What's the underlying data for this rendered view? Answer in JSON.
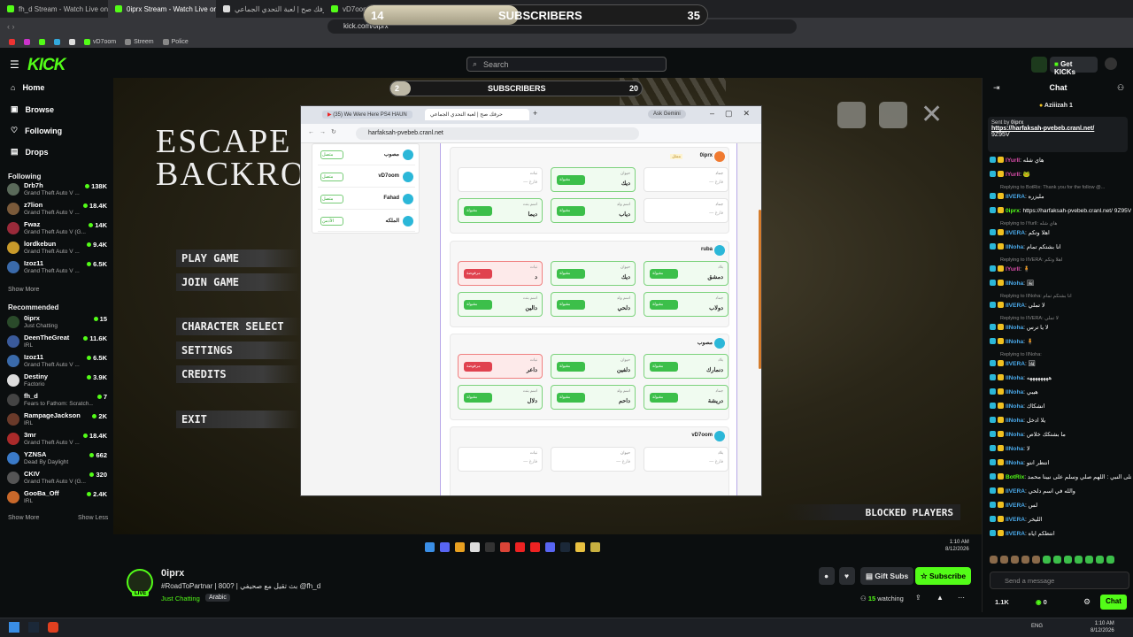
{
  "browser": {
    "tabs": [
      {
        "label": "fh_d Stream - Watch Live on Kick",
        "active": false
      },
      {
        "label": "0iprx Stream - Watch Live on Kick",
        "active": true
      },
      {
        "label": "حرفك صح | لعبة التحدي الجماعي",
        "active": false
      },
      {
        "label": "vD7oom",
        "active": false
      }
    ],
    "url": "kick.com/0iprx",
    "bookmarks": [
      "vD7oom",
      "Streem",
      "Police"
    ]
  },
  "overlay_subscribers": {
    "left": "14",
    "label": "SUBSCRIBERS",
    "right": "35",
    "progress": 0.45
  },
  "kick_header": {
    "logo": "KICK",
    "search_placeholder": "Search",
    "get_kicks": "Get KICKs"
  },
  "sidebar": {
    "nav": [
      "Home",
      "Browse",
      "Following",
      "Drops"
    ],
    "following_title": "Following",
    "following": [
      {
        "name": "Drb7h",
        "game": "Grand Theft Auto V ...",
        "viewers": "138K",
        "color": "#5a6a5a"
      },
      {
        "name": "z7lion",
        "game": "Grand Theft Auto V ...",
        "viewers": "18.4K",
        "color": "#7a5a3a"
      },
      {
        "name": "Fwaz",
        "game": "Grand Theft Auto V (G...",
        "viewers": "14K",
        "color": "#9a2a3a"
      },
      {
        "name": "lordkebun",
        "game": "Grand Theft Auto V ...",
        "viewers": "9.4K",
        "color": "#c89a2a"
      },
      {
        "name": "Izoz11",
        "game": "Grand Theft Auto V ...",
        "viewers": "6.5K",
        "color": "#3a6aaa"
      }
    ],
    "show_more": "Show More",
    "recommended_title": "Recommended",
    "recommended": [
      {
        "name": "0iprx",
        "game": "Just Chatting",
        "viewers": "15",
        "color": "#2a4a2a"
      },
      {
        "name": "DeenTheGreat",
        "game": "IRL",
        "viewers": "11.6K",
        "color": "#3a5a9a"
      },
      {
        "name": "Izoz11",
        "game": "Grand Theft Auto V ...",
        "viewers": "6.5K",
        "color": "#3a6aaa"
      },
      {
        "name": "Destiny",
        "game": "Factorio",
        "viewers": "3.9K",
        "color": "#dddddd"
      },
      {
        "name": "fh_d",
        "game": "Fears to Fathom: Scratch...",
        "viewers": "7",
        "color": "#444"
      },
      {
        "name": "RampageJackson",
        "game": "IRL",
        "viewers": "2K",
        "color": "#6a3a2a"
      },
      {
        "name": "3mr",
        "game": "Grand Theft Auto V ...",
        "viewers": "18.4K",
        "color": "#aa2a2a"
      },
      {
        "name": "YZNSA",
        "game": "Dead By Daylight",
        "viewers": "662",
        "color": "#3a7ac8"
      },
      {
        "name": "CKIV",
        "game": "Grand Theft Auto V (G...",
        "viewers": "320",
        "color": "#555"
      },
      {
        "name": "GooBa_Off",
        "game": "IRL",
        "viewers": "2.4K",
        "color": "#c8682a"
      }
    ],
    "show_more2": "Show More",
    "show_less": "Show Less"
  },
  "game": {
    "title_line1": "ESCAPE",
    "title_line2": "BACKRO",
    "menu": [
      "PLAY GAME",
      "JOIN GAME",
      "CHARACTER SELECT",
      "SETTINGS",
      "CREDITS",
      "EXIT"
    ],
    "blocked": "BLOCKED PLAYERS",
    "subs_left": "2",
    "subs_label": "SUBSCRIBERS",
    "subs_right": "20",
    "subs_progress": 0.08
  },
  "inner_browser": {
    "tab1": "(35) We Were Here PS4 HAUN",
    "tab2": "حرفك صح | لعبة التحدي الجماعي",
    "ask": "Ask Gemini",
    "url": "harfaksah-pvebeb.cranl.net",
    "players": [
      {
        "name": "مصوب",
        "status": "متصل"
      },
      {
        "name": "vD7oom",
        "status": "متصل"
      },
      {
        "name": "Fahad",
        "status": "متصل"
      },
      {
        "name": "الملكه",
        "status": "الأدمن"
      }
    ],
    "cards": [
      {
        "title": "0iprx",
        "tag": "ممثل",
        "rows": [
          [
            {
              "l": "جماد",
              "v": "",
              "b": ""
            },
            {
              "l": "حيوان",
              "v": "ديك",
              "b": "g"
            },
            {
              "l": "نبات",
              "v": "",
              "b": ""
            }
          ],
          [
            {
              "l": "جماد",
              "v": "",
              "b": ""
            },
            {
              "l": "اسم ولد",
              "v": "دياب",
              "b": "g"
            },
            {
              "l": "اسم بنت",
              "v": "ديما",
              "b": "g"
            }
          ]
        ]
      },
      {
        "title": "ruba",
        "tag": "",
        "rows": [
          [
            {
              "l": "بلاد",
              "v": "دمشق",
              "b": "g"
            },
            {
              "l": "حيوان",
              "v": "ديك",
              "b": "g"
            },
            {
              "l": "نبات",
              "v": "د",
              "b": "r"
            }
          ],
          [
            {
              "l": "جماد",
              "v": "دولاب",
              "b": "g"
            },
            {
              "l": "اسم ولد",
              "v": "دلحي",
              "b": "g"
            },
            {
              "l": "اسم بنت",
              "v": "دالين",
              "b": "g"
            }
          ]
        ]
      },
      {
        "title": "مصوب",
        "tag": "",
        "rows": [
          [
            {
              "l": "بلاد",
              "v": "دنمارك",
              "b": "g"
            },
            {
              "l": "حيوان",
              "v": "دلفين",
              "b": "g"
            },
            {
              "l": "نبات",
              "v": "داعر",
              "b": "r"
            }
          ],
          [
            {
              "l": "جماد",
              "v": "دريشة",
              "b": "g"
            },
            {
              "l": "اسم ولد",
              "v": "داحم",
              "b": "g"
            },
            {
              "l": "اسم بنت",
              "v": "دلال",
              "b": "g"
            }
          ]
        ]
      },
      {
        "title": "vD7oom",
        "tag": "",
        "rows": [
          [
            {
              "l": "بلاد",
              "v": "",
              "b": ""
            },
            {
              "l": "حيوان",
              "v": "",
              "b": ""
            },
            {
              "l": "نبات",
              "v": "",
              "b": ""
            }
          ]
        ]
      }
    ],
    "badge_ok": "مقبولة",
    "badge_bad": "مرفوضة",
    "empty": "— فارغ"
  },
  "chat": {
    "title": "Chat",
    "top_user": "Aziiizah",
    "top_count": "1",
    "pinned_by": "Sent by",
    "pinned_user": "0iprx",
    "pinned_link": "https://harfaksah-pvebeb.cranl.net/",
    "pinned_code": "9Z95V",
    "messages": [
      {
        "u": "IYurlI",
        "c": "#d94ca8",
        "t": "هاي شله"
      },
      {
        "u": "IYurlI",
        "c": "#d94ca8",
        "t": "🐸"
      },
      {
        "r": "Replying to BotRix: Thank you for the follow @..."
      },
      {
        "u": "IIVERA",
        "c": "#4aa8e8",
        "t": "مليزره"
      },
      {
        "u": "0iprx",
        "c": "#53fc18",
        "t": "https://harfaksah-pvebeb.cranl.net/ 9Z95V"
      },
      {
        "r": "Replying to IYurlI: هاي شله"
      },
      {
        "u": "IIVERA",
        "c": "#4aa8e8",
        "t": "اهلا وتكم"
      },
      {
        "u": "IINoha",
        "c": "#4aa8e8",
        "t": "انا بشتكم تمام"
      },
      {
        "r": "Replying to IIVERA: اهلا وتكم"
      },
      {
        "u": "IYurlI",
        "c": "#d94ca8",
        "t": "🧍"
      },
      {
        "u": "IINoha",
        "c": "#4aa8e8",
        "t": "🖼"
      },
      {
        "r": "Replying to IINoha: انا بشتكم تمام"
      },
      {
        "u": "IIVERA",
        "c": "#4aa8e8",
        "t": "لا تملي"
      },
      {
        "r": "Replying to IIVERA: لا تملي"
      },
      {
        "u": "IINoha",
        "c": "#4aa8e8",
        "t": "لا يا ترس"
      },
      {
        "u": "IINoha",
        "c": "#4aa8e8",
        "t": "🧍"
      },
      {
        "r": "Replying to IINoha:"
      },
      {
        "u": "IIVERA",
        "c": "#4aa8e8",
        "t": "🖼"
      },
      {
        "u": "IINoha",
        "c": "#4aa8e8",
        "t": "ههههههههه"
      },
      {
        "u": "IINoha",
        "c": "#4aa8e8",
        "t": "هيبي"
      },
      {
        "u": "IINoha",
        "c": "#4aa8e8",
        "t": "انشكاك"
      },
      {
        "u": "IINoha",
        "c": "#4aa8e8",
        "t": "يلا ادخل"
      },
      {
        "u": "IINoha",
        "c": "#4aa8e8",
        "t": "ما بشتكك خلاص"
      },
      {
        "u": "IINoha",
        "c": "#4aa8e8",
        "t": "لا"
      },
      {
        "u": "IINoha",
        "c": "#4aa8e8",
        "t": "انتظر انتو"
      },
      {
        "u": "BotRix",
        "c": "#53fc18",
        "t": "صلو على النبي : اللهم صلي وسلم على نبينا محمد"
      },
      {
        "u": "IIVERA",
        "c": "#4aa8e8",
        "t": "والله في اسم دلحي"
      },
      {
        "u": "IIVERA",
        "c": "#4aa8e8",
        "t": "لس"
      },
      {
        "u": "IIVERA",
        "c": "#4aa8e8",
        "t": "الليخر"
      },
      {
        "u": "IIVERA",
        "c": "#4aa8e8",
        "t": "انتظكم اياه"
      }
    ],
    "input_placeholder": "Send a message",
    "kicks": "1.1K",
    "zero": "0",
    "chat_button": "Chat"
  },
  "channel": {
    "name": "0iprx",
    "live": "LIVE",
    "title": "#RoadToPartnar | 800? | بث تقيل مع صحيفي @fh_d",
    "category": "Just Chatting",
    "language": "Arabic",
    "gift": "Gift Subs",
    "subscribe": "Subscribe",
    "watching_count": "15",
    "watching_label": "watching"
  },
  "stream_clock": {
    "time": "1:10 AM",
    "date": "8/12/2026"
  },
  "win_clock": {
    "time": "1:10 AM",
    "date": "8/12/2026",
    "lang": "ENG"
  },
  "colors": {
    "kick_green": "#53fc18"
  }
}
